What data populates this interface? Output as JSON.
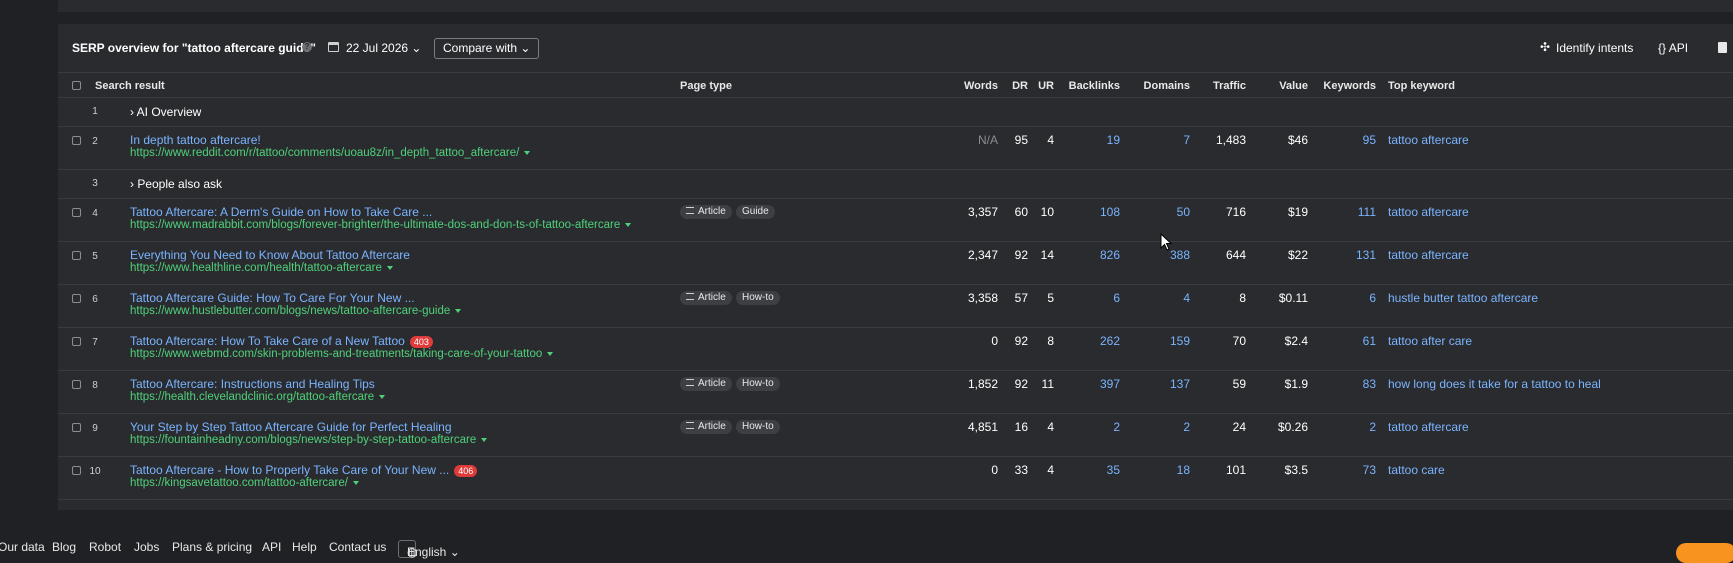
{
  "header": {
    "title": "SERP overview for \"tattoo aftercare guide\"",
    "help_glyph": "?",
    "date": "22 Jul 2026 ⌄",
    "compare": "Compare with ⌄",
    "identify_intents": "Identify intents",
    "api": "{} API"
  },
  "columns": {
    "search_result": "Search result",
    "page_type": "Page type",
    "words": "Words",
    "dr": "DR",
    "ur": "UR",
    "backlinks": "Backlinks",
    "domains": "Domains",
    "traffic": "Traffic",
    "value": "Value",
    "keywords": "Keywords",
    "top_keyword": "Top keyword"
  },
  "rows": [
    {
      "num": "1",
      "group": "› AI Overview"
    },
    {
      "num": "2",
      "title": "In depth tattoo aftercare!",
      "url": "https://www.reddit.com/r/tattoo/comments/uoau8z/in_depth_tattoo_aftercare/",
      "badge": "",
      "types": [],
      "words": "N/A",
      "dr": "95",
      "ur": "4",
      "backlinks": "19",
      "domains": "7",
      "traffic": "1,483",
      "value": "$46",
      "keywords": "95",
      "top_keyword": "tattoo aftercare"
    },
    {
      "num": "3",
      "group": "› People also ask"
    },
    {
      "num": "4",
      "title": "Tattoo Aftercare: A Derm's Guide on How to Take Care ...",
      "url": "https://www.madrabbit.com/blogs/forever-brighter/the-ultimate-dos-and-don-ts-of-tattoo-aftercare",
      "badge": "",
      "types": [
        "Article",
        "Guide"
      ],
      "words": "3,357",
      "dr": "60",
      "ur": "10",
      "backlinks": "108",
      "domains": "50",
      "traffic": "716",
      "value": "$19",
      "keywords": "111",
      "top_keyword": "tattoo aftercare"
    },
    {
      "num": "5",
      "title": "Everything You Need to Know About Tattoo Aftercare",
      "url": "https://www.healthline.com/health/tattoo-aftercare",
      "badge": "",
      "types": [],
      "words": "2,347",
      "dr": "92",
      "ur": "14",
      "backlinks": "826",
      "domains": "388",
      "traffic": "644",
      "value": "$22",
      "keywords": "131",
      "top_keyword": "tattoo aftercare"
    },
    {
      "num": "6",
      "title": "Tattoo Aftercare Guide: How To Care For Your New ...",
      "url": "https://www.hustlebutter.com/blogs/news/tattoo-aftercare-guide",
      "badge": "",
      "types": [
        "Article",
        "How-to"
      ],
      "words": "3,358",
      "dr": "57",
      "ur": "5",
      "backlinks": "6",
      "domains": "4",
      "traffic": "8",
      "value": "$0.11",
      "keywords": "6",
      "top_keyword": "hustle butter tattoo aftercare"
    },
    {
      "num": "7",
      "title": "Tattoo Aftercare: How To Take Care of a New Tattoo",
      "url": "https://www.webmd.com/skin-problems-and-treatments/taking-care-of-your-tattoo",
      "badge": "403",
      "types": [],
      "words": "0",
      "dr": "92",
      "ur": "8",
      "backlinks": "262",
      "domains": "159",
      "traffic": "70",
      "value": "$2.4",
      "keywords": "61",
      "top_keyword": "tattoo after care"
    },
    {
      "num": "8",
      "title": "Tattoo Aftercare: Instructions and Healing Tips",
      "url": "https://health.clevelandclinic.org/tattoo-aftercare",
      "badge": "",
      "types": [
        "Article",
        "How-to"
      ],
      "words": "1,852",
      "dr": "92",
      "ur": "11",
      "backlinks": "397",
      "domains": "137",
      "traffic": "59",
      "value": "$1.9",
      "keywords": "83",
      "top_keyword": "how long does it take for a tattoo to heal"
    },
    {
      "num": "9",
      "title": "Your Step by Step Tattoo Aftercare Guide for Perfect Healing",
      "url": "https://fountainheadny.com/blogs/news/step-by-step-tattoo-aftercare",
      "badge": "",
      "types": [
        "Article",
        "How-to"
      ],
      "words": "4,851",
      "dr": "16",
      "ur": "4",
      "backlinks": "2",
      "domains": "2",
      "traffic": "24",
      "value": "$0.26",
      "keywords": "2",
      "top_keyword": "tattoo aftercare"
    },
    {
      "num": "10",
      "title": "Tattoo Aftercare - How to Properly Take Care of Your New ...",
      "url": "https://kingsavetattoo.com/tattoo-aftercare/",
      "badge": "406",
      "types": [],
      "words": "0",
      "dr": "33",
      "ur": "4",
      "backlinks": "35",
      "domains": "18",
      "traffic": "101",
      "value": "$3.5",
      "keywords": "73",
      "top_keyword": "tattoo care"
    }
  ],
  "footer": {
    "links": [
      "Our data",
      "Blog",
      "Robot",
      "Jobs",
      "Plans & pricing",
      "API",
      "Help",
      "Contact us"
    ],
    "language": "English ⌄"
  },
  "colors": {
    "accent_link": "#7ab4ff",
    "url_green": "#4fd17a",
    "badge_red": "#e03b3b",
    "cta_orange": "#f7931e"
  }
}
